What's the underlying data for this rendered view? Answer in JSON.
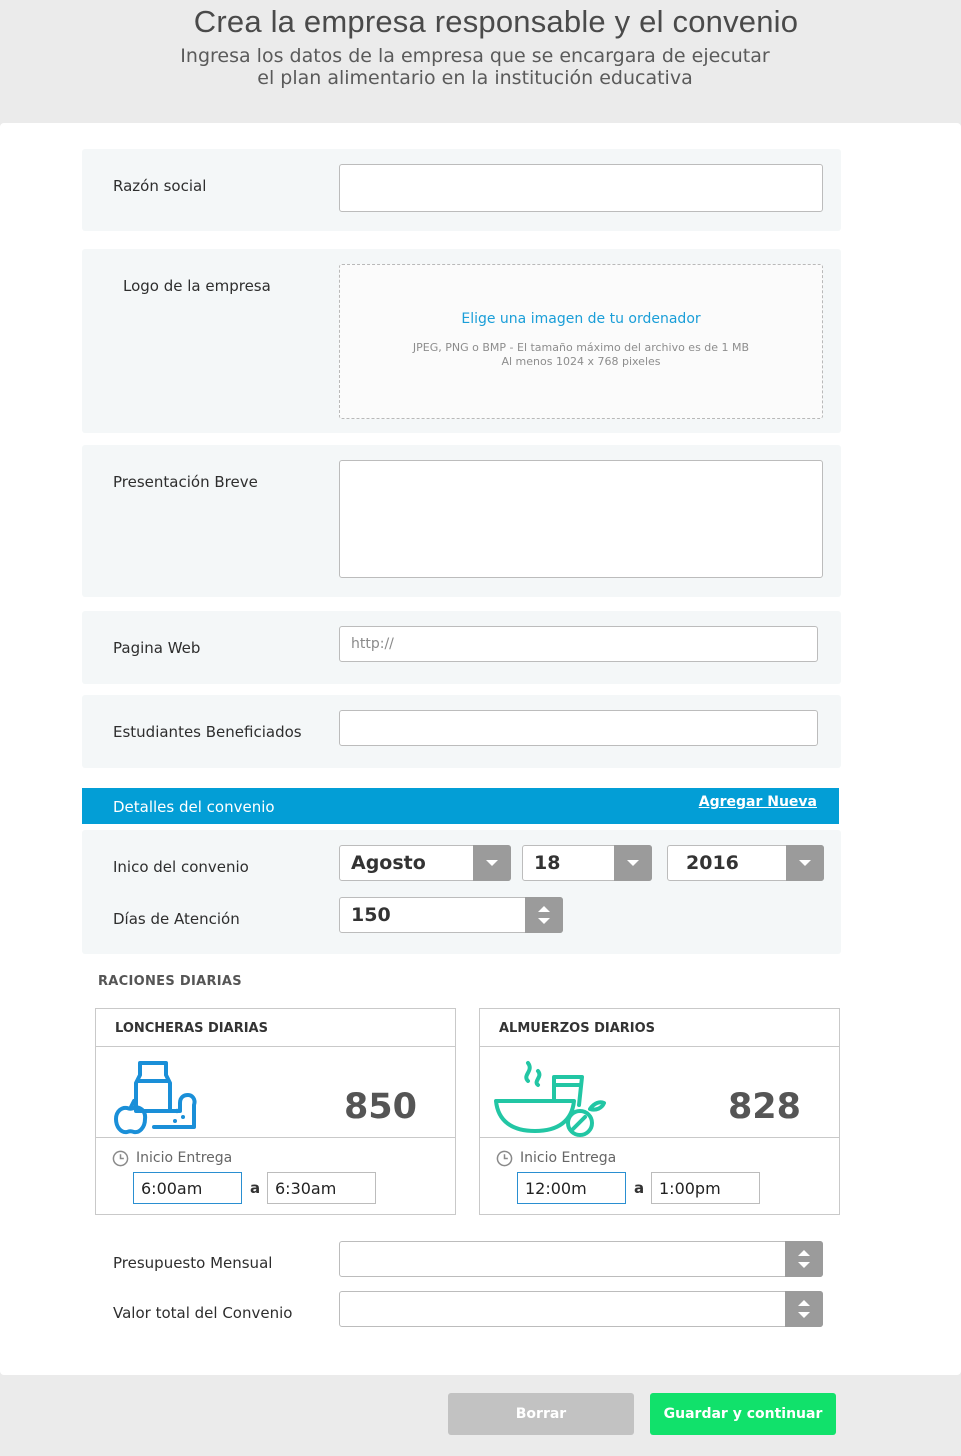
{
  "header": {
    "title": "Crea la empresa responsable y el convenio",
    "subtitle_line1": "Ingresa los datos de la empresa que se encargara de ejecutar",
    "subtitle_line2": "el plan alimentario en la institución educativa"
  },
  "form": {
    "razon_social": {
      "label": "Razón social",
      "value": ""
    },
    "logo": {
      "label": "Logo de la empresa",
      "link": "Elige una imagen de tu ordenador",
      "hint_line1": "JPEG, PNG o BMP - El tamaño máximo del archivo es de 1 MB",
      "hint_line2": "Al menos 1024 x 768 pixeles"
    },
    "presentacion": {
      "label": "Presentación Breve",
      "value": ""
    },
    "pagina_web": {
      "label": "Pagina Web",
      "placeholder": "http://"
    },
    "estudiantes": {
      "label": "Estudiantes Beneficiados",
      "value": ""
    }
  },
  "convenio": {
    "section_title": "Detalles del convenio",
    "add_link": "Agregar Nueva",
    "inicio_label": "Inico del convenio",
    "month": "Agosto",
    "day": "18",
    "year": "2016",
    "dias_label": "Días de Atención",
    "dias_value": "150"
  },
  "raciones": {
    "title": "RACIONES DIARIAS",
    "loncheras": {
      "title": "LONCHERAS DIARIAS",
      "count": "850",
      "start_label": "Inicio Entrega",
      "from": "6:00am",
      "sep": "a",
      "to": "6:30am"
    },
    "almuerzos": {
      "title": "ALMUERZOS DIARIOS",
      "count": "828",
      "start_label": "Inicio Entrega",
      "from": "12:00m",
      "sep": "a",
      "to": "1:00pm"
    }
  },
  "budget": {
    "presupuesto_label": "Presupuesto Mensual",
    "valor_label": "Valor total del Convenio"
  },
  "actions": {
    "clear": "Borrar",
    "save": "Guardar y continuar"
  },
  "colors": {
    "accent_blue": "#039ed6",
    "save_green": "#11e16b",
    "loncheras_icon": "#1a8fd8",
    "almuerzos_icon": "#22c6a4"
  },
  "icons": {
    "loncheras": "milk-apple-bread-icon",
    "almuerzos": "soup-bowl-drink-icon",
    "clock": "clock-icon"
  }
}
